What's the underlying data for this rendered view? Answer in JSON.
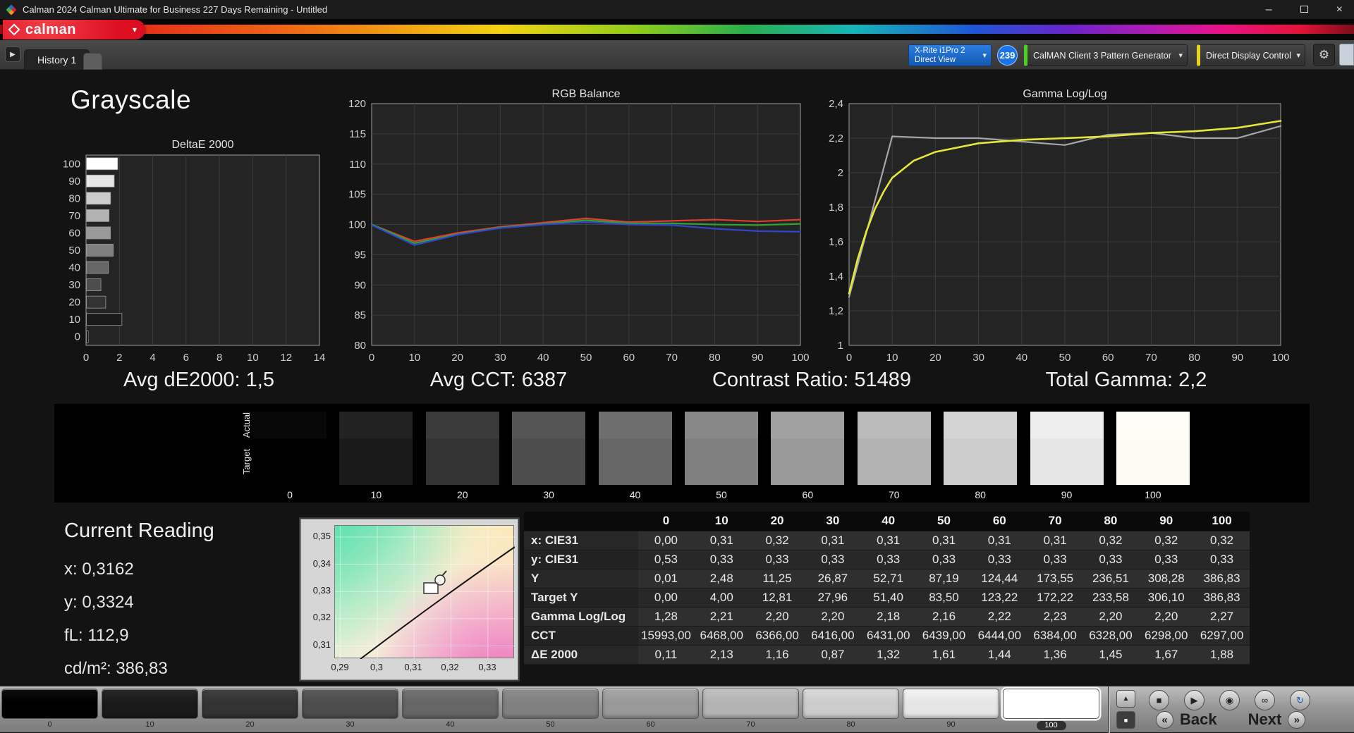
{
  "titlebar": {
    "title": "Calman 2024 Calman Ultimate for Business 227 Days Remaining  - Untitled"
  },
  "icons": {
    "minimize": "–",
    "close": "×",
    "dropdown": "▾",
    "gear": "⚙",
    "tab_arrow": "▶",
    "stop": "■",
    "play": "▶",
    "record": "◉",
    "link": "∞",
    "refresh": "↻",
    "eject": "▲",
    "pattern_window": "■",
    "back_chevrons": "«",
    "next_chevrons": "»"
  },
  "brand": {
    "logo_text": "calman"
  },
  "tabbar": {
    "history_tab": "History 1",
    "meter_line1": "X-Rite i1Pro 2",
    "meter_line2": "Direct View",
    "meter_badge": "239",
    "pattern_source": "CalMAN Client 3 Pattern Generator",
    "display_control": "Direct Display Control"
  },
  "page": {
    "title": "Grayscale"
  },
  "summary": [
    "Avg dE2000: 1,5",
    "Avg CCT: 6387",
    "Contrast Ratio: 51489",
    "Total Gamma: 2,2"
  ],
  "swatches": {
    "actual_label": "Actual",
    "target_label": "Target",
    "levels": [
      "0",
      "10",
      "20",
      "30",
      "40",
      "50",
      "60",
      "70",
      "80",
      "90",
      "100"
    ]
  },
  "current_reading": {
    "title": "Current Reading",
    "x": "x: 0,3162",
    "y": "y: 0,3324",
    "fl": "fL: 112,9",
    "cdm2": "cd/m²: 386,83"
  },
  "cie": {
    "y_ticks": [
      "0,35",
      "0,34",
      "0,33",
      "0,32",
      "0,31"
    ],
    "x_ticks": [
      "0,29",
      "0,3",
      "0,31",
      "0,32",
      "0,33"
    ]
  },
  "table": {
    "headers": [
      "",
      "0",
      "10",
      "20",
      "30",
      "40",
      "50",
      "60",
      "70",
      "80",
      "90",
      "100"
    ],
    "rows": [
      {
        "label": "x: CIE31",
        "values": [
          "0,00",
          "0,31",
          "0,32",
          "0,31",
          "0,31",
          "0,31",
          "0,31",
          "0,31",
          "0,32",
          "0,32",
          "0,32"
        ]
      },
      {
        "label": "y: CIE31",
        "values": [
          "0,53",
          "0,33",
          "0,33",
          "0,33",
          "0,33",
          "0,33",
          "0,33",
          "0,33",
          "0,33",
          "0,33",
          "0,33"
        ]
      },
      {
        "label": "Y",
        "values": [
          "0,01",
          "2,48",
          "11,25",
          "26,87",
          "52,71",
          "87,19",
          "124,44",
          "173,55",
          "236,51",
          "308,28",
          "386,83"
        ]
      },
      {
        "label": "Target Y",
        "values": [
          "0,00",
          "4,00",
          "12,81",
          "27,96",
          "51,40",
          "83,50",
          "123,22",
          "172,22",
          "233,58",
          "306,10",
          "386,83"
        ]
      },
      {
        "label": "Gamma Log/Log",
        "values": [
          "1,28",
          "2,21",
          "2,20",
          "2,20",
          "2,18",
          "2,16",
          "2,22",
          "2,23",
          "2,20",
          "2,20",
          "2,27"
        ]
      },
      {
        "label": "CCT",
        "values": [
          "15993,00",
          "6468,00",
          "6366,00",
          "6416,00",
          "6431,00",
          "6439,00",
          "6444,00",
          "6384,00",
          "6328,00",
          "6298,00",
          "6297,00"
        ]
      },
      {
        "label": "ΔE 2000",
        "values": [
          "0,11",
          "2,13",
          "1,16",
          "0,87",
          "1,32",
          "1,61",
          "1,44",
          "1,36",
          "1,45",
          "1,67",
          "1,88"
        ]
      }
    ]
  },
  "pattern_bar": {
    "levels": [
      "0",
      "10",
      "20",
      "30",
      "40",
      "50",
      "60",
      "70",
      "80",
      "90",
      "100"
    ],
    "selected": "100",
    "back": "Back",
    "next": "Next"
  },
  "colors": {
    "calman_red": "#e8192c",
    "meter_blue": "#1a73d1",
    "pattern_green": "#49d41f",
    "display_yellow": "#e8d51f",
    "rgb_red": "#e03c30",
    "rgb_green": "#2fa32f",
    "rgb_blue": "#3046d0",
    "gamma_yellow": "#e7e73a",
    "gamma_gray": "#a6a6a6"
  },
  "chart_data": [
    {
      "id": "deltae",
      "type": "bar",
      "orientation": "horizontal",
      "title": "DeltaE 2000",
      "categories": [
        100,
        90,
        80,
        70,
        60,
        50,
        40,
        30,
        20,
        10,
        0
      ],
      "values": [
        1.88,
        1.67,
        1.45,
        1.36,
        1.44,
        1.61,
        1.32,
        0.87,
        1.16,
        2.13,
        0.11
      ],
      "xlim": [
        0,
        14
      ],
      "xticks": [
        0,
        2,
        4,
        6,
        8,
        10,
        12,
        14
      ],
      "grid": true
    },
    {
      "id": "rgb_balance",
      "type": "line",
      "title": "RGB Balance",
      "x": [
        0,
        10,
        20,
        30,
        40,
        50,
        60,
        70,
        80,
        90,
        100
      ],
      "xticks": [
        0,
        10,
        20,
        30,
        40,
        50,
        60,
        70,
        80,
        90,
        100
      ],
      "ylim": [
        80,
        120
      ],
      "yticks": [
        120,
        115,
        110,
        105,
        100,
        95,
        90,
        85,
        80
      ],
      "ytick_labels": [
        "120",
        "115",
        "110",
        "105",
        "100",
        "95",
        "90",
        "85",
        "80"
      ],
      "grid": true,
      "series": [
        {
          "name": "red",
          "color": "#e03c30",
          "width": 2.2,
          "values": [
            100,
            97.2,
            98.6,
            99.6,
            100.3,
            101.0,
            100.4,
            100.6,
            100.8,
            100.5,
            100.8
          ]
        },
        {
          "name": "green",
          "color": "#2fa32f",
          "width": 2.2,
          "values": [
            100,
            96.9,
            98.4,
            99.5,
            100.1,
            100.7,
            100.2,
            100.2,
            100.0,
            99.9,
            100.1
          ]
        },
        {
          "name": "blue",
          "color": "#3046d0",
          "width": 2.2,
          "values": [
            99.9,
            96.6,
            98.3,
            99.4,
            100.0,
            100.4,
            100.0,
            99.9,
            99.3,
            98.9,
            98.8
          ]
        }
      ]
    },
    {
      "id": "gamma",
      "type": "line",
      "title": "Gamma Log/Log",
      "x": [
        0,
        10,
        20,
        30,
        40,
        50,
        60,
        70,
        80,
        90,
        100
      ],
      "xticks": [
        0,
        10,
        20,
        30,
        40,
        50,
        60,
        70,
        80,
        90,
        100
      ],
      "ylim": [
        1,
        2.4
      ],
      "yticks": [
        2.4,
        2.2,
        2,
        1.8,
        1.6,
        1.4,
        1.2,
        1
      ],
      "ytick_labels": [
        "2,4",
        "2,2",
        "2",
        "1,8",
        "1,6",
        "1,4",
        "1,2",
        "1"
      ],
      "grid": true,
      "series": [
        {
          "name": "measured",
          "color": "#a6a6a6",
          "width": 2.2,
          "values": [
            1.28,
            2.21,
            2.2,
            2.2,
            2.18,
            2.16,
            2.22,
            2.23,
            2.2,
            2.2,
            2.27
          ]
        },
        {
          "name": "target",
          "color": "#e7e73a",
          "width": 2.6,
          "x": [
            0,
            2,
            4,
            6,
            8,
            10,
            15,
            20,
            30,
            40,
            50,
            60,
            70,
            80,
            90,
            100
          ],
          "values": [
            1.3,
            1.5,
            1.66,
            1.79,
            1.89,
            1.97,
            2.07,
            2.12,
            2.17,
            2.19,
            2.2,
            2.21,
            2.23,
            2.24,
            2.26,
            2.3
          ]
        }
      ]
    }
  ]
}
